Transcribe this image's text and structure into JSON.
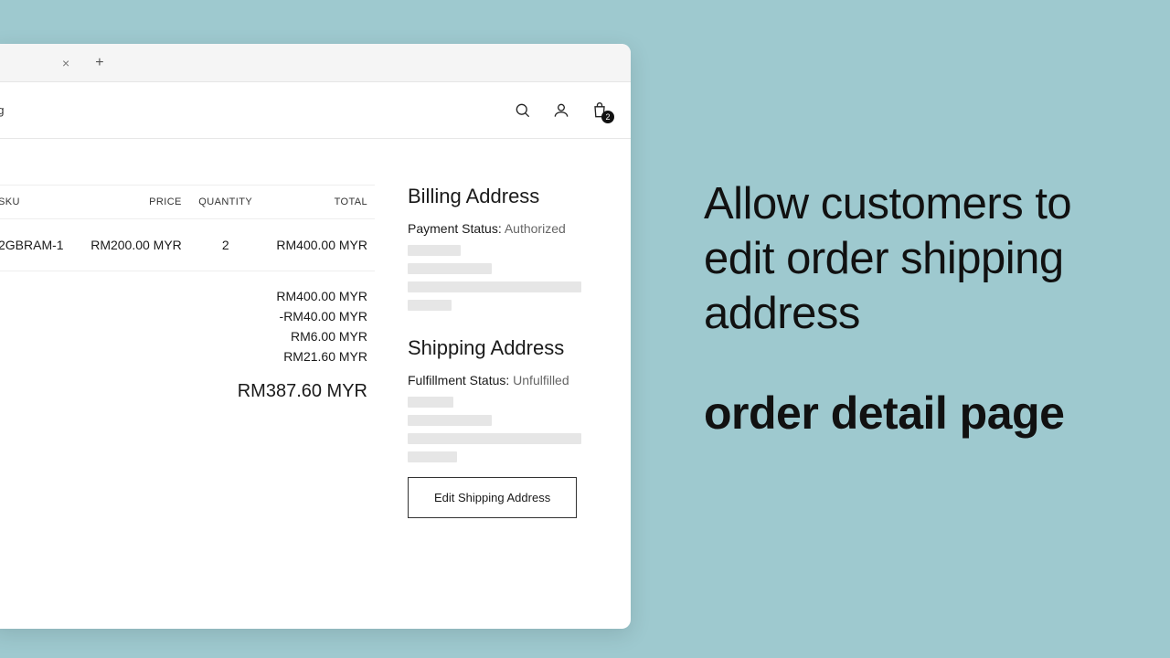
{
  "nav": {
    "link_text": "og",
    "cart_count": "2"
  },
  "order_table": {
    "headers": {
      "sku": "SKU",
      "price": "PRICE",
      "qty": "QUANTITY",
      "total": "TOTAL"
    },
    "row": {
      "sku": "2GBRAM-1",
      "price": "RM200.00 MYR",
      "qty": "2",
      "total": "RM400.00 MYR"
    },
    "totals": {
      "subtotal": "RM400.00 MYR",
      "discount": "-RM40.00 MYR",
      "shipping": "RM6.00 MYR",
      "tax": "RM21.60 MYR",
      "grand": "RM387.60 MYR"
    }
  },
  "billing": {
    "title": "Billing Address",
    "status_label": "Payment Status: ",
    "status_value": "Authorized"
  },
  "shipping": {
    "title": "Shipping Address",
    "status_label": "Fulfillment Status: ",
    "status_value": "Unfulfilled",
    "edit_button": "Edit Shipping Address"
  },
  "marketing": {
    "headline": "Allow customers to edit order shipping address",
    "subhead": "order detail page"
  }
}
